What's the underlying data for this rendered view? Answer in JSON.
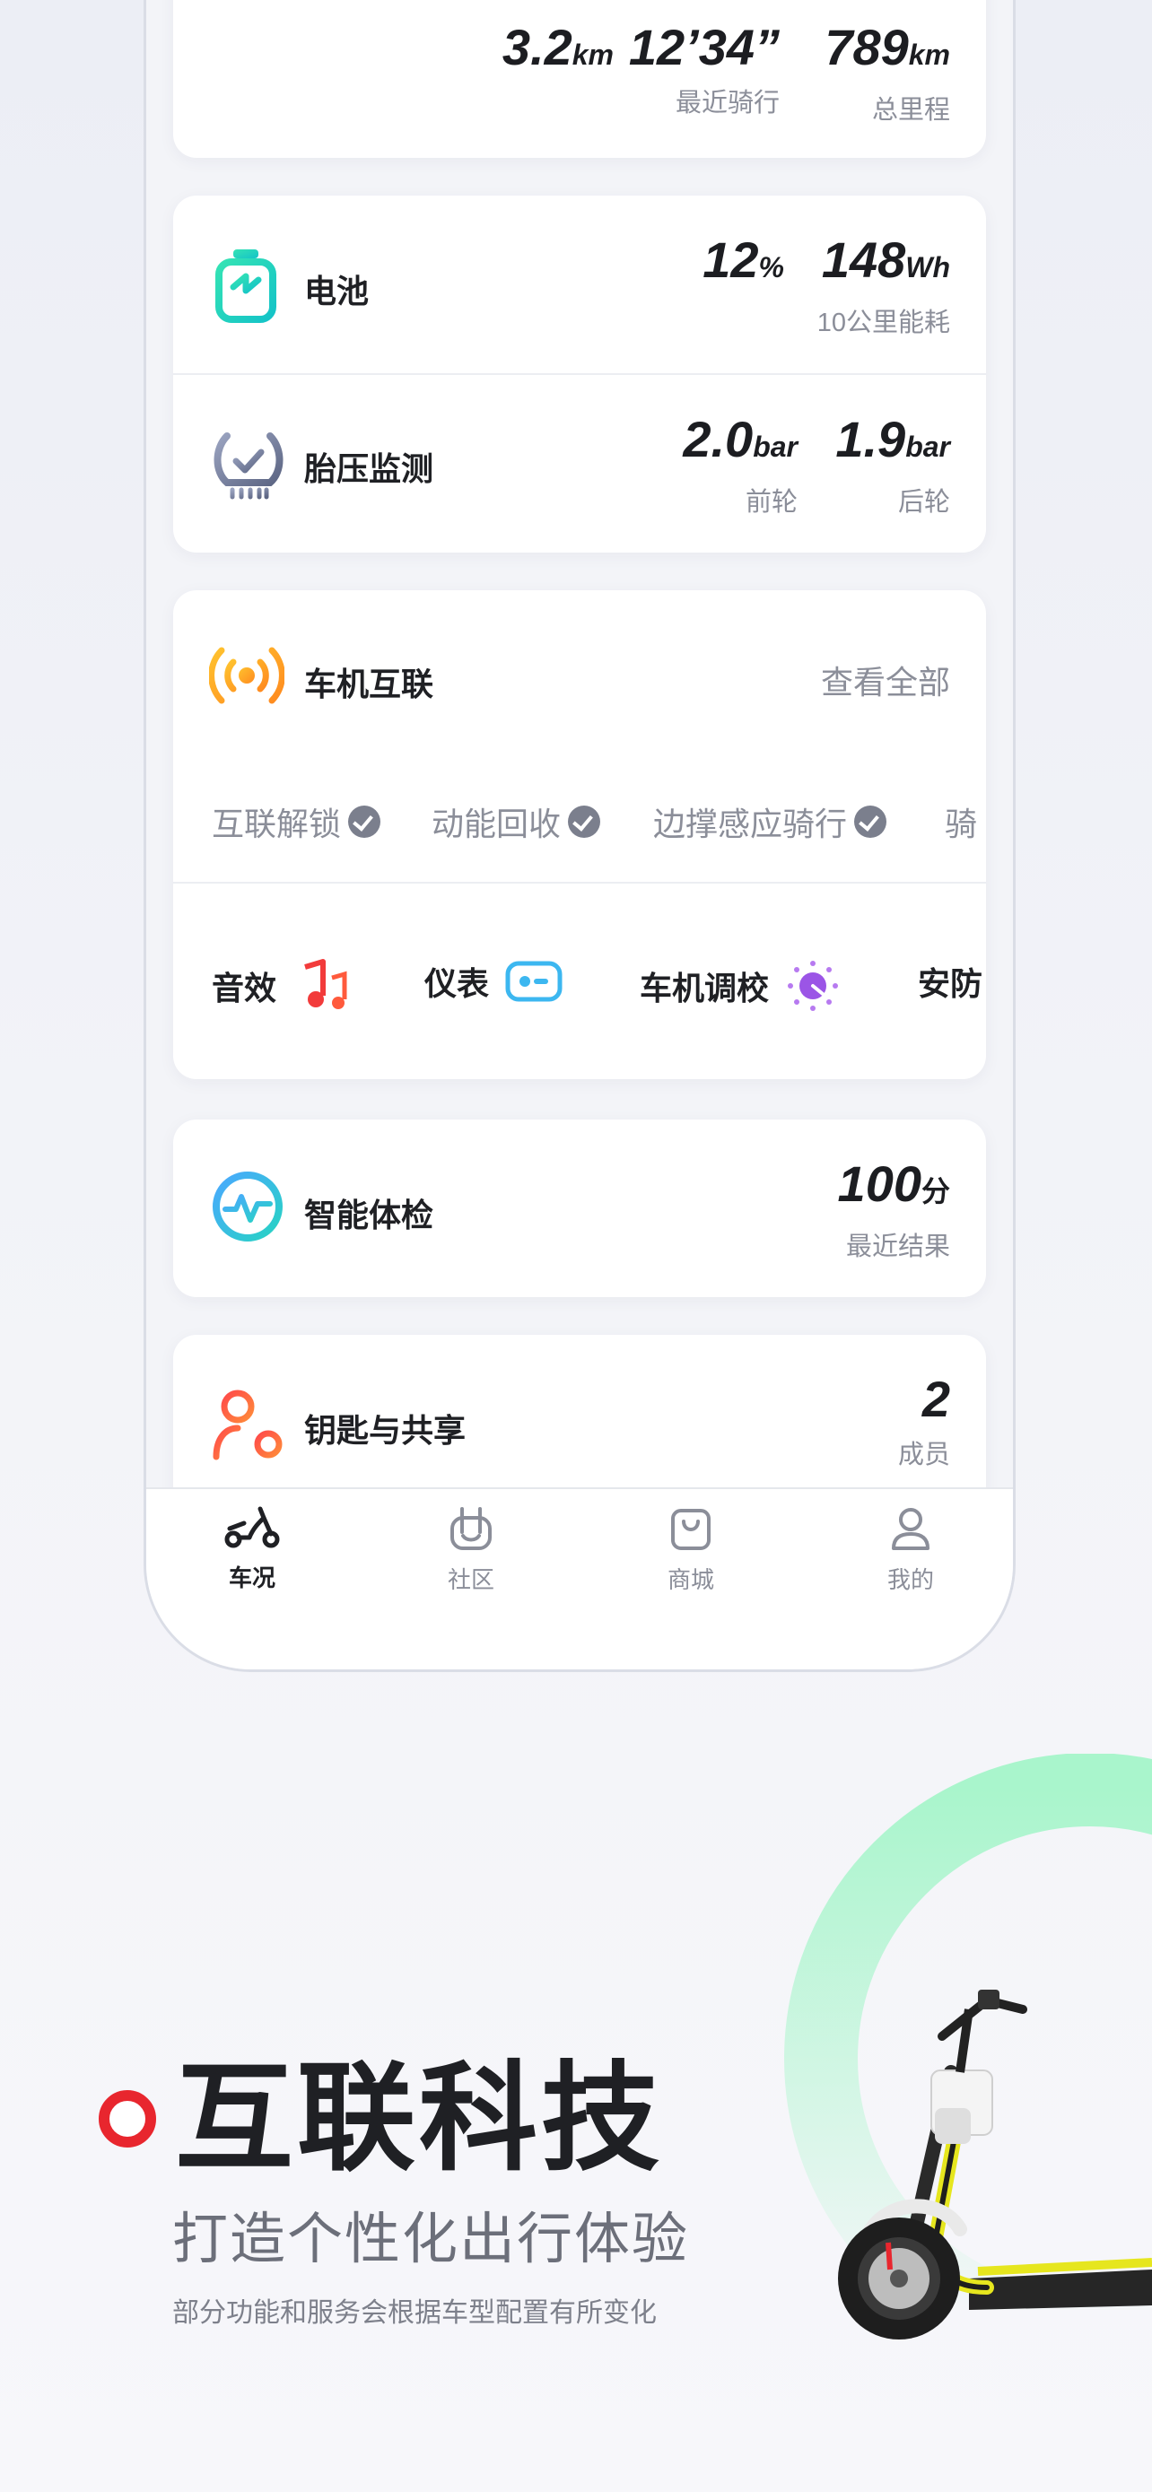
{
  "ride": {
    "distance_value": "3.2",
    "distance_unit": "km",
    "time_value": "12’34”",
    "recent_label": "最近骑行",
    "odometer_value": "789",
    "odometer_unit": "km",
    "odometer_label": "总里程"
  },
  "battery": {
    "title": "电池",
    "percent_value": "12",
    "percent_unit": "%",
    "energy_value": "148",
    "energy_unit": "Wh",
    "energy_label": "10公里能耗"
  },
  "tire": {
    "title": "胎压监测",
    "front_value": "2.0",
    "front_unit": "bar",
    "front_label": "前轮",
    "rear_value": "1.9",
    "rear_unit": "bar",
    "rear_label": "后轮"
  },
  "connect": {
    "title": "车机互联",
    "view_all": "查看全部",
    "features": [
      "互联解锁",
      "动能回收",
      "边撑感应骑行",
      "骑"
    ],
    "functions": [
      "音效",
      "仪表",
      "车机调校",
      "安防"
    ]
  },
  "health": {
    "title": "智能体检",
    "score_value": "100",
    "score_unit": "分",
    "score_label": "最近结果"
  },
  "keys": {
    "title": "钥匙与共享",
    "members_value": "2",
    "members_label": "成员"
  },
  "tabbar": {
    "tabs": [
      "车况",
      "社区",
      "商城",
      "我的"
    ],
    "active": "车况"
  },
  "promo": {
    "title": "互联科技",
    "subtitle": "打造个性化出行体验",
    "note": "部分功能和服务会根据车型配置有所变化"
  },
  "colors": {
    "accent_red": "#e8262e",
    "accent_green": "#a9f5cc",
    "scooter_yellow": "#e6e61e"
  },
  "icons": [
    "battery-icon",
    "tire-pressure-icon",
    "signal-icon",
    "music-icon",
    "dashboard-icon",
    "tuning-icon",
    "health-check-icon",
    "key-share-icon",
    "scooter-icon",
    "community-icon",
    "shop-icon",
    "profile-icon"
  ]
}
